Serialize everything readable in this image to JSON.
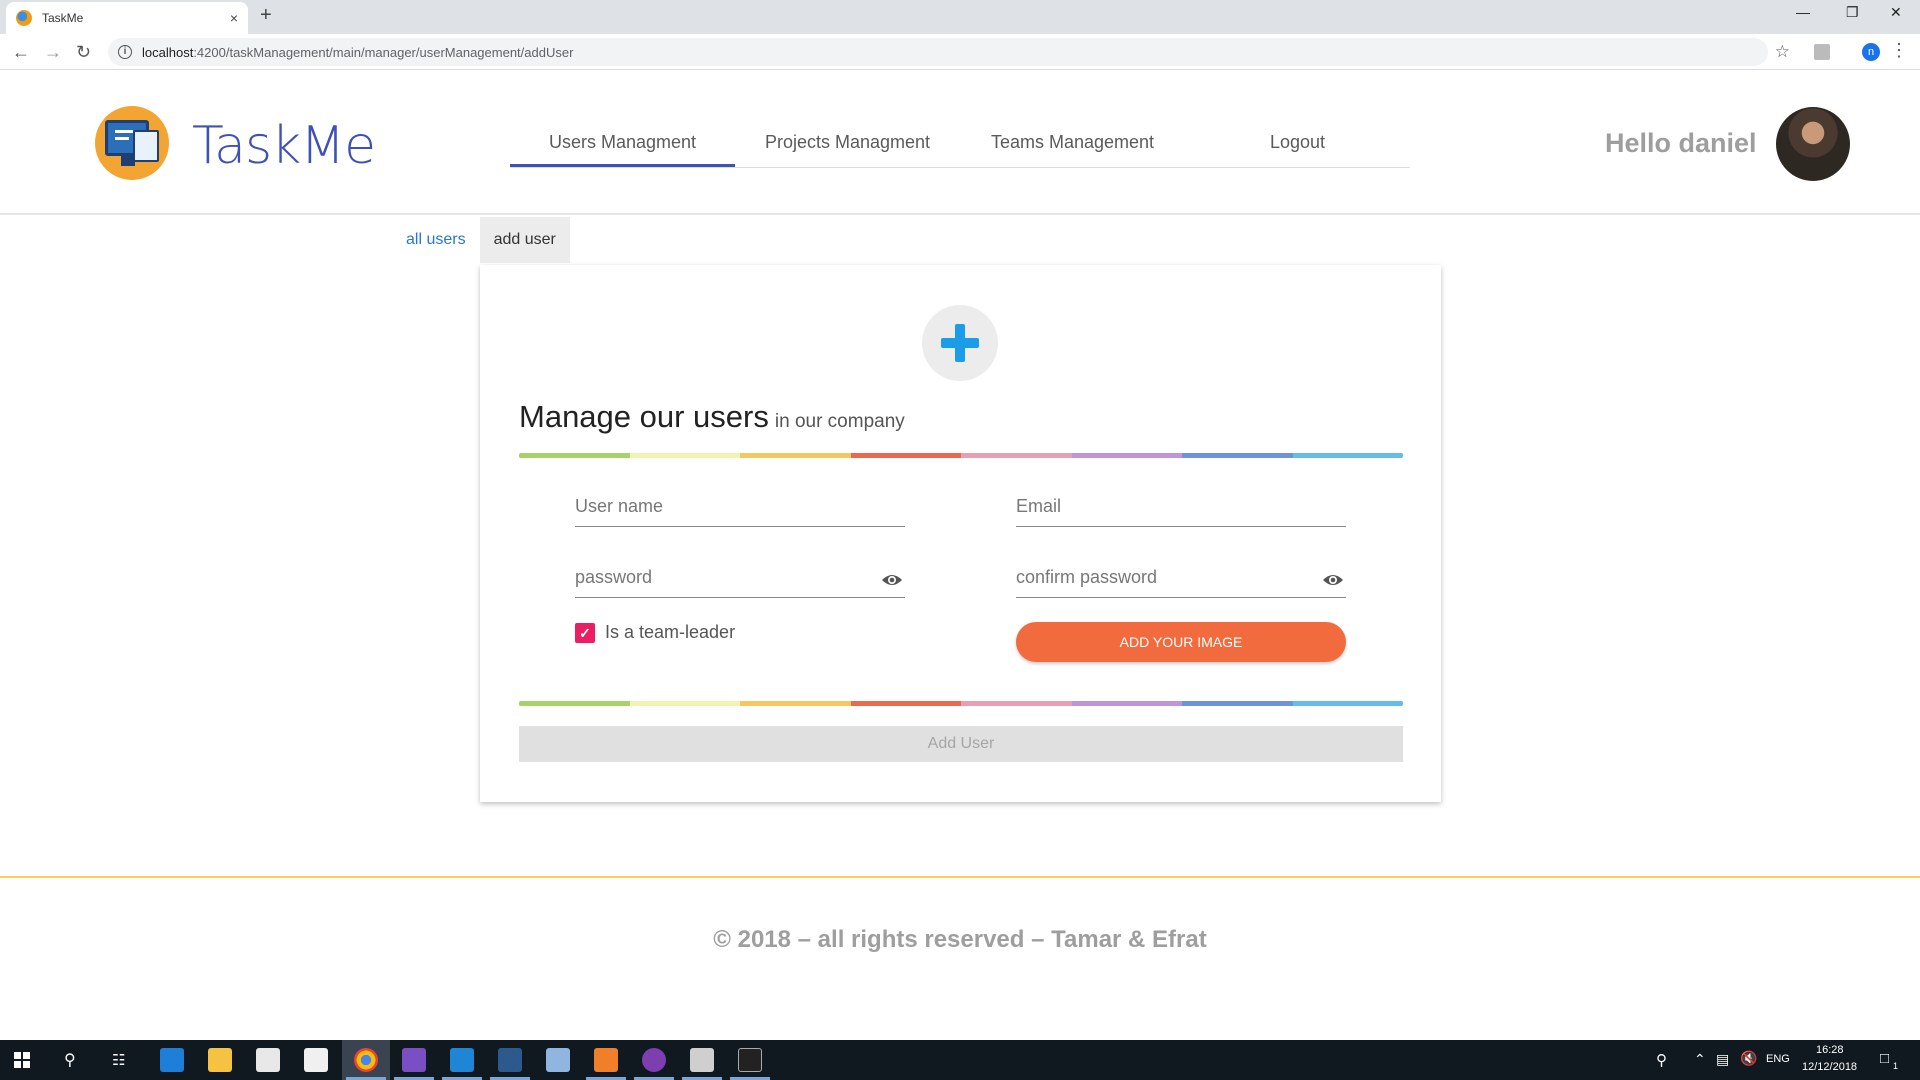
{
  "browser": {
    "tab_title": "TaskMe",
    "tab_close": "×",
    "new_tab": "+",
    "url_host": "localhost",
    "url_rest": ":4200/taskManagement/main/manager/userManagement/addUser",
    "profile_initial": "n"
  },
  "app": {
    "brand": "TaskMe",
    "nav": [
      "Users Managment",
      "Projects Managment",
      "Teams Management",
      "Logout"
    ],
    "active_nav": "Users Managment",
    "greeting": "Hello daniel"
  },
  "subtabs": {
    "all_users": "all users",
    "add_user": "add user"
  },
  "form": {
    "title": "Manage our users",
    "subtitle": "in our company",
    "username_placeholder": "User name",
    "email_placeholder": "Email",
    "password_placeholder": "password",
    "confirm_placeholder": "confirm password",
    "team_leader_label": "Is a team-leader",
    "team_leader_checked": true,
    "add_image_label": "ADD YOUR IMAGE",
    "submit_label": "Add User",
    "rainbow_colors": [
      "#a6d16b",
      "#f3f3b0",
      "#f5c760",
      "#ea6a4e",
      "#e79fb3",
      "#c194d6",
      "#6f93d8",
      "#65bde6"
    ]
  },
  "footer": {
    "text": "© 2018 – all rights reserved – Tamar & Efrat"
  },
  "taskbar": {
    "lang": "ENG",
    "time": "16:28",
    "date": "12/12/2018",
    "notification_count": "1"
  },
  "colors": {
    "accent": "#3f51b5",
    "orange_button": "#f26b3e",
    "checkbox": "#e91e63",
    "plus": "#1a9ce8"
  }
}
